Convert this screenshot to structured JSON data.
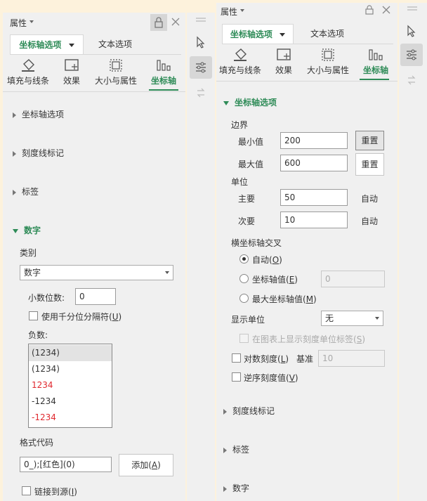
{
  "left": {
    "panel_title": "属性",
    "tabs": [
      "坐标轴选项",
      "文本选项"
    ],
    "categories": [
      "填充与线条",
      "效果",
      "大小与属性",
      "坐标轴"
    ],
    "sections": [
      "坐标轴选项",
      "刻度线标记",
      "标签"
    ],
    "number": {
      "heading": "数字",
      "category_label": "类别",
      "category_value": "数字",
      "decimals_label": "小数位数:",
      "decimals_value": "0",
      "thousands_label": "使用千分位分隔符(",
      "thousands_key": "U",
      "negative_label": "负数:",
      "negative_options": [
        "(1234)",
        "(1234)",
        "1234",
        "-1234",
        "-1234"
      ],
      "format_code_label": "格式代码",
      "format_code_value": "0_);[红色](0)",
      "add_label_pre": "添加(",
      "add_key": "A",
      "link_label_pre": "链接到源(",
      "link_key": "I"
    }
  },
  "right": {
    "panel_title": "属性",
    "tabs": [
      "坐标轴选项",
      "文本选项"
    ],
    "categories": [
      "填充与线条",
      "效果",
      "大小与属性",
      "坐标轴"
    ],
    "axis_options": {
      "heading": "坐标轴选项",
      "bounds_label": "边界",
      "min_label": "最小值",
      "min_value": "200",
      "max_label": "最大值",
      "max_value": "600",
      "reset_label": "重置",
      "units_label": "单位",
      "major_label": "主要",
      "major_value": "50",
      "minor_label": "次要",
      "minor_value": "10",
      "auto_label": "自动",
      "cross_label": "横坐标轴交叉",
      "cross_auto_pre": "自动(",
      "cross_auto_key": "O",
      "cross_value_pre": "坐标轴值(",
      "cross_value_key": "E",
      "cross_value": "0",
      "cross_max_pre": "最大坐标轴值(",
      "cross_max_key": "M",
      "display_units_label": "显示单位",
      "display_units_value": "无",
      "show_units_label_pre": "在图表上显示刻度单位标签(",
      "show_units_label_key": "S",
      "log_scale_pre": "对数刻度(",
      "log_scale_key": "L",
      "base_label": "基准",
      "base_value": "10",
      "reverse_pre": "逆序刻度值(",
      "reverse_key": "V"
    },
    "sections": [
      "刻度线标记",
      "标签",
      "数字"
    ]
  }
}
